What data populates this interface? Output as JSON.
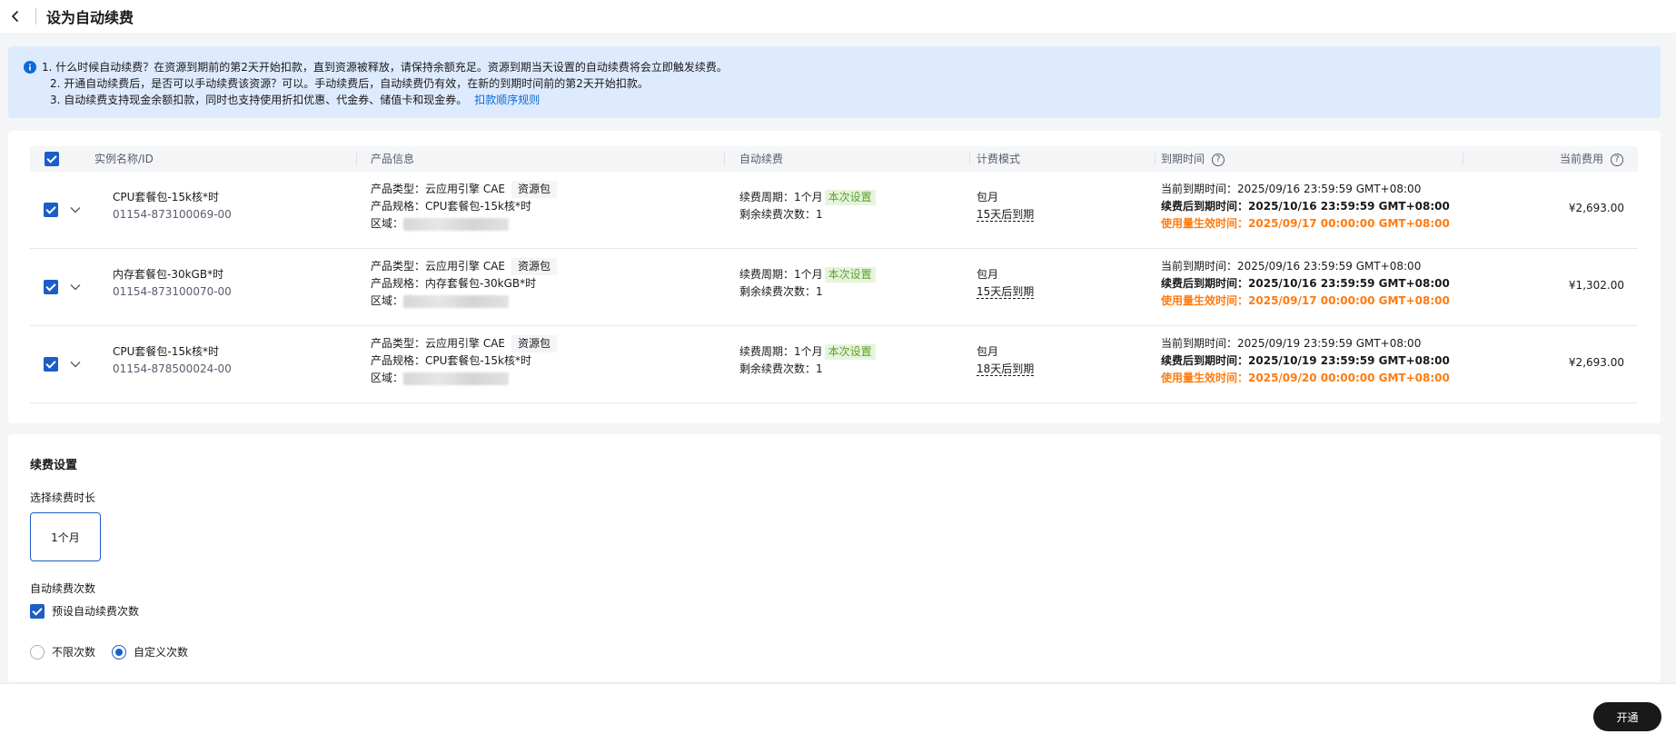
{
  "header": {
    "title": "设为自动续费"
  },
  "notice": {
    "lines": [
      "1. 什么时候自动续费？在资源到期前的第2天开始扣款，直到资源被释放，请保持余额充足。资源到期当天设置的自动续费将会立即触发续费。",
      "2. 开通自动续费后，是否可以手动续费该资源？可以。手动续费后，自动续费仍有效，在新的到期时间前的第2天开始扣款。",
      "3. 自动续费支持现金余额扣款，同时也支持使用折扣优惠、代金券、储值卡和现金券。"
    ],
    "link": "扣款顺序规则"
  },
  "table": {
    "columns": {
      "instance": "实例名称/ID",
      "product": "产品信息",
      "autorenew": "自动续费",
      "billing": "计费模式",
      "expiry": "到期时间",
      "cost": "当前费用"
    },
    "labels": {
      "product_type": "产品类型：",
      "product_spec": "产品规格：",
      "region": "区域：",
      "period": "续费周期：",
      "remaining": "剩余续费次数：",
      "current_expiry": "当前到期时间：",
      "after_expiry": "续费后到期时间：",
      "effective": "使用量生效时间："
    },
    "rows": [
      {
        "name": "CPU套餐包-15k核*时",
        "id": "01154-873100069-00",
        "type": "云应用引擎 CAE",
        "tag": "资源包",
        "spec": "CPU套餐包-15k核*时",
        "period": "1个月",
        "period_tag": "本次设置",
        "remaining": "1",
        "billing": "包月",
        "expire_in": "15天后到期",
        "current_expiry": "2025/09/16 23:59:59 GMT+08:00",
        "after_expiry": "2025/10/16 23:59:59 GMT+08:00",
        "effective": "2025/09/17 00:00:00 GMT+08:00",
        "cost": "¥2,693.00"
      },
      {
        "name": "内存套餐包-30kGB*时",
        "id": "01154-873100070-00",
        "type": "云应用引擎 CAE",
        "tag": "资源包",
        "spec": "内存套餐包-30kGB*时",
        "period": "1个月",
        "period_tag": "本次设置",
        "remaining": "1",
        "billing": "包月",
        "expire_in": "15天后到期",
        "current_expiry": "2025/09/16 23:59:59 GMT+08:00",
        "after_expiry": "2025/10/16 23:59:59 GMT+08:00",
        "effective": "2025/09/17 00:00:00 GMT+08:00",
        "cost": "¥1,302.00"
      },
      {
        "name": "CPU套餐包-15k核*时",
        "id": "01154-878500024-00",
        "type": "云应用引擎 CAE",
        "tag": "资源包",
        "spec": "CPU套餐包-15k核*时",
        "period": "1个月",
        "period_tag": "本次设置",
        "remaining": "1",
        "billing": "包月",
        "expire_in": "18天后到期",
        "current_expiry": "2025/09/19 23:59:59 GMT+08:00",
        "after_expiry": "2025/10/19 23:59:59 GMT+08:00",
        "effective": "2025/09/20 00:00:00 GMT+08:00",
        "cost": "¥2,693.00"
      }
    ]
  },
  "settings": {
    "title": "续费设置",
    "duration_label": "选择续费时长",
    "duration_value": "1个月",
    "count_label": "自动续费次数",
    "preset_label": "预设自动续费次数",
    "radio_unlimited": "不限次数",
    "radio_custom": "自定义次数"
  },
  "footer": {
    "open_label": "开通"
  },
  "colors": {
    "primary": "#1b5ec6",
    "accent_orange": "#ff7b0f",
    "notice_bg": "#deebfe",
    "tag_green": "#5ca02e"
  }
}
